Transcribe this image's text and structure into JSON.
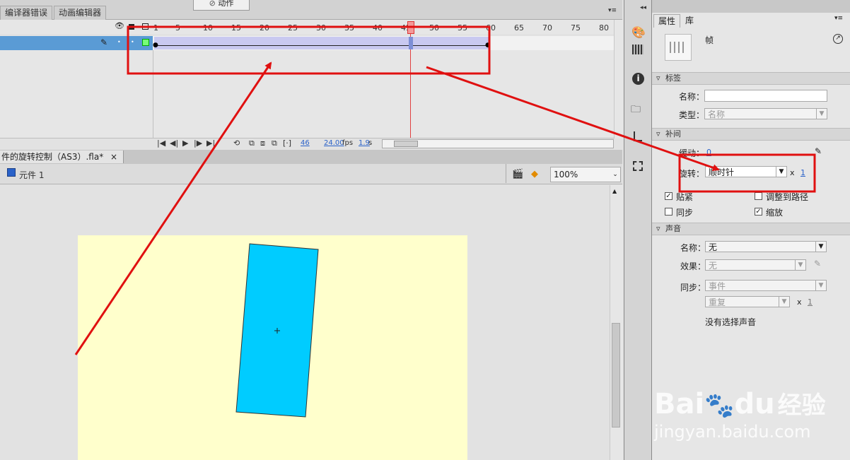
{
  "panel_tabs": {
    "compiler_errors": "编译器错误",
    "motion_editor": "动画编辑器"
  },
  "actions_popup": {
    "label": "动作"
  },
  "timeline": {
    "ruler_labels": [
      "1",
      "5",
      "10",
      "15",
      "20",
      "25",
      "30",
      "35",
      "40",
      "45",
      "50",
      "55",
      "60",
      "65",
      "70",
      "75",
      "80"
    ],
    "current_frame": "46",
    "fps": "24.00",
    "fps_unit": "fps",
    "time": "1.9",
    "time_unit": "s"
  },
  "doc": {
    "title": "件的旋转控制（AS3）.fla*",
    "close": "×",
    "symbol": "元件 1",
    "zoom": "100%"
  },
  "props": {
    "tabs": [
      "属性",
      "库"
    ],
    "type_label": "帧",
    "section_label": "标签",
    "name_label": "名称：",
    "name_value": "",
    "type_field_label": "类型：",
    "type_value": "名称",
    "section_tween": "补间",
    "ease_label": "缓动：",
    "ease_value": "0",
    "rotate_label": "旋转：",
    "rotate_value": "顺时针",
    "rotate_times_x": "x",
    "rotate_times": "1",
    "snap_label": "贴紧",
    "orient_label": "调整到路径",
    "sync_label": "同步",
    "scale_label": "缩放",
    "section_sound": "声音",
    "sound_name_label": "名称：",
    "sound_name_value": "无",
    "effect_label": "效果：",
    "effect_value": "无",
    "sync_field_label": "同步：",
    "sync_value": "事件",
    "repeat_value": "重复",
    "repeat_x": "x",
    "repeat_count": "1",
    "no_sound": "没有选择声音"
  },
  "watermark": {
    "brand": "Bai",
    "brand2": "du",
    "brand3": "经验",
    "url": "jingyan.baidu.com"
  },
  "colors": {
    "accent_red": "#e01010",
    "shape_fill": "#00ccff",
    "stage": "#ffffcc"
  }
}
